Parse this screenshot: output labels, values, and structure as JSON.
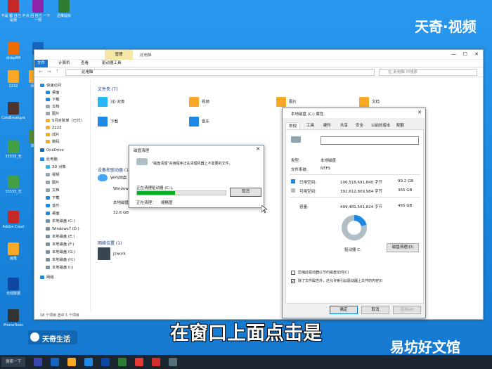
{
  "watermarks": {
    "top_right": "天奇·视频",
    "bottom_left": "天奇生活",
    "bottom_right": "易坊好文馆"
  },
  "subtitle": "在窗口上面点击是",
  "desktop_icons": [
    {
      "label": "不是 都 自己 不是我",
      "color": "#c62828"
    },
    {
      "label": "点 回 自己 一下一刻",
      "color": "#8e24aa"
    },
    {
      "label": "迅推鼠标",
      "color": "#2e7d32"
    },
    {
      "label": "dirbp8M",
      "color": "#ef6c00"
    },
    {
      "label": "",
      "color": "#1565c0"
    },
    {
      "label": "2222",
      "color": "#f9a825"
    },
    {
      "label": "网络",
      "color": "#f9a825"
    },
    {
      "label": "ColoBreakgra",
      "color": "#4e342e"
    },
    {
      "label": "数码",
      "color": "#558b2f"
    },
    {
      "label": "33333_无",
      "color": "#43a047"
    },
    {
      "label": "33333_无",
      "color": "#43a047"
    },
    {
      "label": "Adobe Creat",
      "color": "#c62828"
    },
    {
      "label": "画笔",
      "color": "#f9a825"
    },
    {
      "label": "无线数据",
      "color": "#0d47a1"
    },
    {
      "label": "PhoneTools",
      "color": "#333333"
    }
  ],
  "explorer": {
    "ribbon_group": "管理",
    "window_title": "此电脑",
    "tabs": [
      "文件",
      "计算机",
      "查看",
      "驱动器工具"
    ],
    "address": "此电脑",
    "search_placeholder": "在 此电脑 中搜索",
    "nav": [
      {
        "label": "快速访问",
        "color": "#1e88e5"
      },
      {
        "label": "桌面",
        "color": "#1e88e5"
      },
      {
        "label": "下载",
        "color": "#1e88e5"
      },
      {
        "label": "文档",
        "color": "#90a4ae"
      },
      {
        "label": "图片",
        "color": "#90a4ae"
      },
      {
        "label": "5月对账单（已付）",
        "color": "#f9a825"
      },
      {
        "label": "2222",
        "color": "#f9a825"
      },
      {
        "label": "成片",
        "color": "#f9a825"
      },
      {
        "label": "数码",
        "color": "#f9a825"
      },
      {
        "label": "OneDrive",
        "color": "#1565c0"
      },
      {
        "label": "此电脑",
        "color": "#1e88e5"
      },
      {
        "label": "3D 对象",
        "color": "#29b6f6"
      },
      {
        "label": "视频",
        "color": "#90a4ae"
      },
      {
        "label": "图片",
        "color": "#90a4ae"
      },
      {
        "label": "文档",
        "color": "#90a4ae"
      },
      {
        "label": "下载",
        "color": "#1e88e5"
      },
      {
        "label": "音乐",
        "color": "#1e88e5"
      },
      {
        "label": "桌面",
        "color": "#1e88e5"
      },
      {
        "label": "本地磁盘 (C:)",
        "color": "#78909c"
      },
      {
        "label": "Windows7 (D:)",
        "color": "#78909c"
      },
      {
        "label": "本地磁盘 (E:)",
        "color": "#78909c"
      },
      {
        "label": "本地磁盘 (F:)",
        "color": "#78909c"
      },
      {
        "label": "本地磁盘 (G:)",
        "color": "#78909c"
      },
      {
        "label": "本地磁盘 (H:)",
        "color": "#78909c"
      },
      {
        "label": "本地磁盘 (I:)",
        "color": "#78909c"
      },
      {
        "label": "网络",
        "color": "#1e88e5"
      }
    ],
    "folders_header": "文件夹 (7)",
    "folders": [
      {
        "label": "3D 对象",
        "color": "#29b6f6"
      },
      {
        "label": "视频",
        "color": "#f9a825"
      },
      {
        "label": "图片",
        "color": "#f9a825"
      },
      {
        "label": "文档",
        "color": "#f9a825"
      },
      {
        "label": "下载",
        "color": "#1e88e5"
      },
      {
        "label": "音乐",
        "color": "#1e88e5"
      }
    ],
    "drives_header": "设备和驱动器 (10)",
    "drives": [
      {
        "label": "WPS网盘"
      },
      {
        "label": "Window"
      },
      {
        "label": "本地磁盘",
        "sub": "22.6 GB"
      },
      {
        "label": "32.6 GB"
      }
    ],
    "network_header": "网络位置 (1)",
    "network": [
      {
        "label": "Jzwork"
      }
    ],
    "status": "18 个项目    选中 1 个项目"
  },
  "cleanup": {
    "title": "磁盘清理",
    "message": "\"磁盘清理\"实用程序正在清理机器上不需要的文件。",
    "progress_label": "正在清理驱动器 (C:)。",
    "progress": 0.43,
    "cancel": "取消",
    "status_label": "正在清理：",
    "status_value": "缩略图"
  },
  "properties": {
    "title": "本地磁盘 (C:) 属性",
    "tabs": [
      "常规",
      "工具",
      "硬件",
      "共享",
      "安全",
      "以前的版本",
      "配额"
    ],
    "type_label": "类型:",
    "type_value": "本地磁盘",
    "fs_label": "文件系统:",
    "fs_value": "NTFS",
    "used_label": "已用空间:",
    "used_bytes": "106,518,691,840 字节",
    "used_gb": "99.2 GB",
    "free_label": "可用空间:",
    "free_bytes": "392,612,809,984 字节",
    "free_gb": "365 GB",
    "cap_label": "容量:",
    "cap_bytes": "499,481,501,824 字节",
    "cap_gb": "465 GB",
    "used_fraction": 0.213,
    "drive_label": "驱动器 C:",
    "cleanup_btn": "磁盘清理(D)",
    "check1": "压缩此驱动器以节约磁盘空间(C)",
    "check2": "除了文件属性外，还允许索引此驱动器上文件的内容(I)",
    "check2_checked": true,
    "ok": "确定",
    "cancel": "取消",
    "apply": "应用(A)",
    "used_color": "#1e88e5",
    "free_color": "#b0bec5"
  },
  "taskbar": {
    "start": "搜索一下",
    "apps": [
      {
        "color": "#3949ab"
      },
      {
        "color": "#1565c0"
      },
      {
        "color": "#f9a825"
      },
      {
        "color": "#1e88e5"
      },
      {
        "color": "#0d47a1"
      },
      {
        "color": "#2e7d32"
      },
      {
        "color": "#e53935"
      },
      {
        "color": "#d32f2f"
      },
      {
        "color": "#546e7a"
      }
    ]
  }
}
